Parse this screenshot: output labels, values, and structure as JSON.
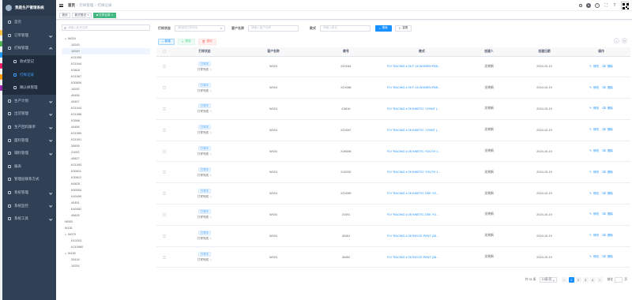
{
  "app": {
    "title": "我是生产管理系统"
  },
  "sidebar": {
    "items": [
      {
        "label": "首页",
        "icon": "home-icon"
      },
      {
        "label": "订单管理",
        "icon": "order-icon",
        "arrow": true
      },
      {
        "label": "打样管理",
        "icon": "sample-icon",
        "arrow": true,
        "open": true
      },
      {
        "label": "款式登记",
        "icon": "style-icon",
        "sub": true
      },
      {
        "label": "打样记录",
        "icon": "record-icon",
        "sub": true,
        "active": true
      },
      {
        "label": "确认样管理",
        "icon": "confirm-icon",
        "sub": true
      },
      {
        "label": "生产计划",
        "icon": "plan-icon",
        "arrow": true
      },
      {
        "label": "出货管理",
        "icon": "ship-icon",
        "arrow": true
      },
      {
        "label": "生产回料跟单",
        "icon": "material-icon",
        "arrow": true
      },
      {
        "label": "面料管理",
        "icon": "fabric-icon",
        "arrow": true
      },
      {
        "label": "辅料管理",
        "icon": "accessory-icon",
        "arrow": true
      },
      {
        "label": "报表",
        "icon": "report-icon"
      },
      {
        "label": "管理层联系方式",
        "icon": "contact-icon"
      },
      {
        "label": "系统管理",
        "icon": "gear-icon",
        "arrow": true
      },
      {
        "label": "系统监控",
        "icon": "monitor-icon",
        "arrow": true
      },
      {
        "label": "系统工具",
        "icon": "tool-icon",
        "arrow": true
      }
    ]
  },
  "breadcrumb": {
    "items": [
      "首页",
      "打样管理",
      "打样记录"
    ]
  },
  "tags": [
    {
      "label": "首页",
      "active": false,
      "close": false
    },
    {
      "label": "款式登记",
      "active": false,
      "close": true
    },
    {
      "label": "打样记录",
      "active": true,
      "close": true
    }
  ],
  "tree": {
    "search_placeholder": "请输入款号名称",
    "nodes": [
      {
        "label": "W024",
        "level": 0,
        "caret": "open"
      },
      {
        "label": "10245",
        "level": 1
      },
      {
        "label": "10249",
        "level": 1,
        "selected": true
      },
      {
        "label": "K21050",
        "level": 1
      },
      {
        "label": "K21044",
        "level": 1
      },
      {
        "label": "K3616",
        "level": 1
      },
      {
        "label": "K21067",
        "level": 1
      },
      {
        "label": "K30606",
        "level": 1
      },
      {
        "label": "10252",
        "level": 1
      },
      {
        "label": "40456",
        "level": 1
      },
      {
        "label": "40457",
        "level": 1
      },
      {
        "label": "K21044",
        "level": 1
      },
      {
        "label": "K21088",
        "level": 1
      },
      {
        "label": "K3566",
        "level": 1
      },
      {
        "label": "40456",
        "level": 1
      },
      {
        "label": "K21089",
        "level": 1
      },
      {
        "label": "K21091",
        "level": 1
      },
      {
        "label": "30606",
        "level": 1
      },
      {
        "label": "21092",
        "level": 1
      },
      {
        "label": "40827",
        "level": 1
      },
      {
        "label": "K21093",
        "level": 1
      },
      {
        "label": "K30611",
        "level": 1
      },
      {
        "label": "K30612",
        "level": 1
      },
      {
        "label": "K6625",
        "level": 1
      },
      {
        "label": "K50054",
        "level": 1
      },
      {
        "label": "K40499",
        "level": 1
      },
      {
        "label": "40451",
        "level": 1
      },
      {
        "label": "K40452",
        "level": 1
      },
      {
        "label": "40625",
        "level": 1
      },
      {
        "label": "W003",
        "level": 0
      },
      {
        "label": "W151",
        "level": 0
      },
      {
        "label": "W070",
        "level": 0,
        "caret": "open"
      },
      {
        "label": "K10203",
        "level": 1
      },
      {
        "label": "K210980",
        "level": 1
      },
      {
        "label": "W152",
        "level": 0,
        "caret": "open"
      },
      {
        "label": "20416",
        "level": 1
      },
      {
        "label": "10254",
        "level": 1
      }
    ]
  },
  "filters": {
    "status_label": "打样状态",
    "status_placeholder": "请选择打样状态",
    "customer_label": "客户名称",
    "customer_placeholder": "请输入客户名称",
    "style_label": "款式",
    "style_placeholder": "请输入款式",
    "search_button": "搜索",
    "reset_button": "重置"
  },
  "actions": {
    "add": "新增",
    "edit": "修改",
    "delete": "删除"
  },
  "table": {
    "columns": [
      "",
      "打样状态",
      "客户名称",
      "款号",
      "款式",
      "创建人",
      "创建日期",
      "操作"
    ],
    "rows": [
      {
        "status": "打样中",
        "status2": "打样完成",
        "customer": "W024",
        "code": "K21044",
        "style": "FLY RACING # 26 F-16 WOMEN PAN...",
        "creator": "沈晓娟",
        "date": "2024-10-19"
      },
      {
        "status": "打样中",
        "status2": "打样完成",
        "customer": "W024",
        "code": "K21088",
        "style": "FLY RACING # 26 F-16 WOMEN PAN...",
        "creator": "沈晓娟",
        "date": "2024-10-19"
      },
      {
        "status": "打样中",
        "status2": "打样完成",
        "customer": "W024",
        "code": "K3616",
        "style": "FLY RACING # 26 KINETIC 1 PANT (...",
        "creator": "沈晓娟",
        "date": "2024-10-19"
      },
      {
        "status": "打样中",
        "status2": "打样完成",
        "customer": "W024",
        "code": "K21067",
        "style": "FLY RACING # 26 KINETIC 1 PANT (...",
        "creator": "沈晓娟",
        "date": "2024-10-19"
      },
      {
        "status": "打样中",
        "status2": "打样完成",
        "customer": "W024",
        "code": "K30606",
        "style": "FLY RACING # 26 KINETIC YOUTH 1...",
        "creator": "沈晓娟",
        "date": "2024-10-19"
      },
      {
        "status": "打样中",
        "status2": "打样完成",
        "customer": "W024",
        "code": "K10252",
        "style": "FLY RACING # 26 KINETIC YOUTH 1...",
        "creator": "沈晓娟",
        "date": "2024-10-19"
      },
      {
        "status": "打样中",
        "status2": "打样完成",
        "customer": "W024",
        "code": "K21089",
        "style": "FLY RACING # 26 KINETIC DSK YO...",
        "creator": "沈晓娟",
        "date": "2024-10-19"
      },
      {
        "status": "打样中",
        "status2": "打样完成",
        "customer": "W024",
        "code": "21091",
        "style": "FLY RACING # 26 KINETIC DSK YO...",
        "creator": "沈晓娟",
        "date": "2024-10-19"
      },
      {
        "status": "打样中",
        "status2": "打样完成",
        "customer": "W024",
        "code": "40451",
        "style": "FLY RACING # 26 RAYCE PANT (26...",
        "creator": "沈晓娟",
        "date": "2024-10-19"
      },
      {
        "status": "打样中",
        "status2": "打样完成",
        "customer": "W024",
        "code": "40452",
        "style": "FLY RACING # 26 RAYCE PANT (26...",
        "creator": "沈晓娟",
        "date": "2024-10-19"
      }
    ],
    "op_edit": "修改",
    "op_delete": "删除"
  },
  "pagination": {
    "total": "共 31 条",
    "page_size": "10条/页",
    "pages": [
      "1",
      "2",
      "3",
      "4"
    ],
    "current": "1",
    "goto_label": "前往",
    "page_suffix": "页"
  },
  "colors": {
    "sidebar_bg": "#304156",
    "primary": "#1890ff",
    "active_tag": "#42b983"
  }
}
